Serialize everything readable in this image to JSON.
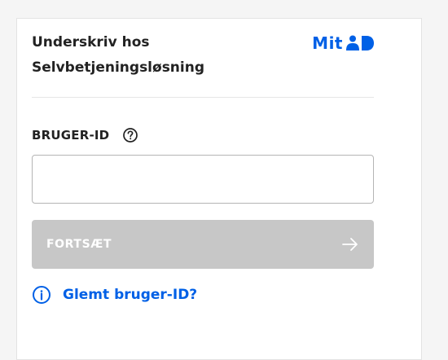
{
  "header": {
    "title_line1": "Underskriv hos",
    "title_line2": "Selvbetjeningsløsning",
    "logo_text": "Mit"
  },
  "form": {
    "field_label": "BRUGER-ID",
    "input_value": "",
    "input_placeholder": "",
    "continue_label": "FORTSÆT",
    "forgot_label": "Glemt bruger-ID?"
  },
  "icons": {
    "logo_mark": "mitid-person-mark",
    "help": "question-circle-icon",
    "arrow": "arrow-right-icon",
    "info": "info-circle-icon"
  },
  "colors": {
    "accent": "#0060e6",
    "button_disabled": "#c7c7c7",
    "text": "#222222",
    "border": "#b5b5b5"
  }
}
